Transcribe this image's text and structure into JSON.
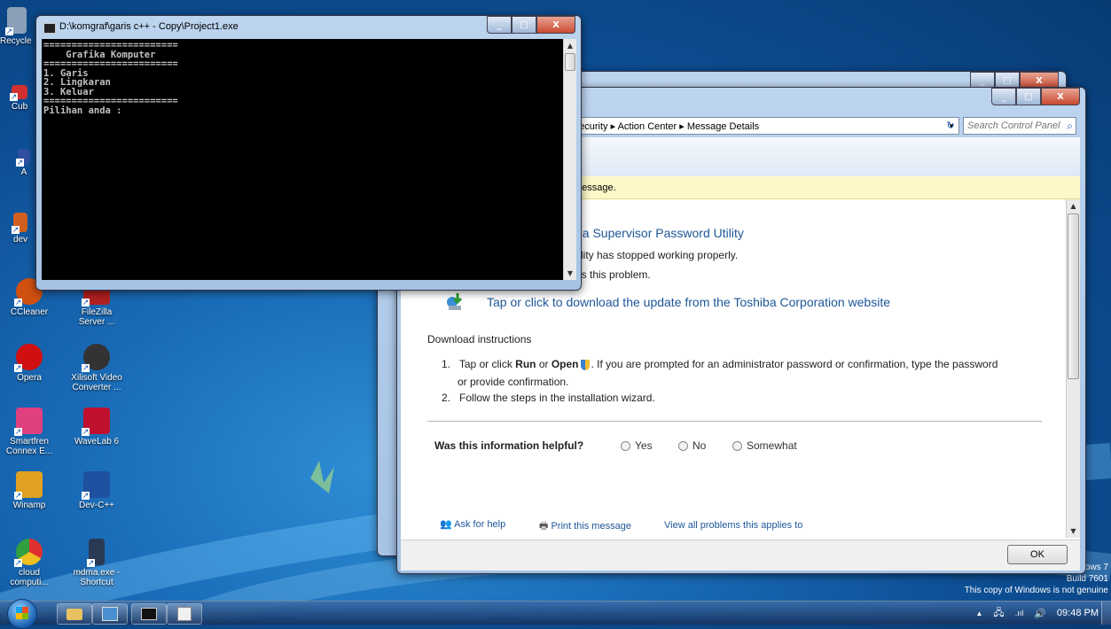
{
  "desktop": {
    "icons": [
      {
        "label": "Recycle Bin",
        "color": "#8aa0b8"
      },
      {
        "label": "Cub",
        "color": "#d03030"
      },
      {
        "label": "A",
        "color": "#3050a0"
      },
      {
        "label": "dev",
        "color": "#d06020"
      },
      {
        "label": "CCleaner",
        "color": "#d05010"
      },
      {
        "label": "FileZilla Server ...",
        "color": "#b02020"
      },
      {
        "label": "Opera",
        "color": "#d01010"
      },
      {
        "label": "Xilisoft Video Converter ...",
        "color": "#333333"
      },
      {
        "label": "Smartfren Connex E...",
        "color": "#e04080"
      },
      {
        "label": "WaveLab 6",
        "color": "#c01030"
      },
      {
        "label": "Winamp",
        "color": "#e0a020"
      },
      {
        "label": "Dev-C++",
        "color": "#2050a0"
      },
      {
        "label": "cloud computi...",
        "color": "#e03030"
      },
      {
        "label": "mdma.exe - Shortcut",
        "color": "#2a3a55"
      }
    ],
    "watermark": {
      "line1": "ows 7",
      "line2": "Build 7601",
      "line3": "This copy of Windows is not genuine"
    }
  },
  "console_window": {
    "title": "D:\\komgraf\\garis c++ - Copy\\Project1.exe",
    "lines": [
      "========================",
      "    Grafika Komputer",
      "========================",
      "1. Garis",
      "2. Lingkaran",
      "3. Keluar",
      "========================",
      "Pilihan anda :"
    ]
  },
  "control_panel": {
    "address": "tem and Security ▸ Action Center ▸ Message Details",
    "search_placeholder": "Search Control Panel",
    "info_bar": "message.",
    "heading": "ba Supervisor Password Utility",
    "desc1": "tility has stopped working properly.",
    "desc2": "es this problem.",
    "download_link": "Tap or click to download the update from the Toshiba Corporation website",
    "download_instructions": "Download instructions",
    "step1_pre": "Tap or click ",
    "step1_run": "Run",
    "step1_or": " or ",
    "step1_open": "Open",
    "step1_post": ".  If you are prompted for an administrator password or confirmation, type the password",
    "step1_cont": "or provide confirmation.",
    "step2": "Follow the steps in the installation wizard.",
    "step1_num": "1.",
    "step2_num": "2.",
    "helpful_q": "Was this information helpful?",
    "opt_yes": "Yes",
    "opt_no": "No",
    "opt_somewhat": "Somewhat",
    "ask_help": "Ask for help",
    "print": "Print this message",
    "view_all": "View all problems this applies to",
    "ok": "OK"
  },
  "taskbar": {
    "time": "09:48 PM"
  }
}
